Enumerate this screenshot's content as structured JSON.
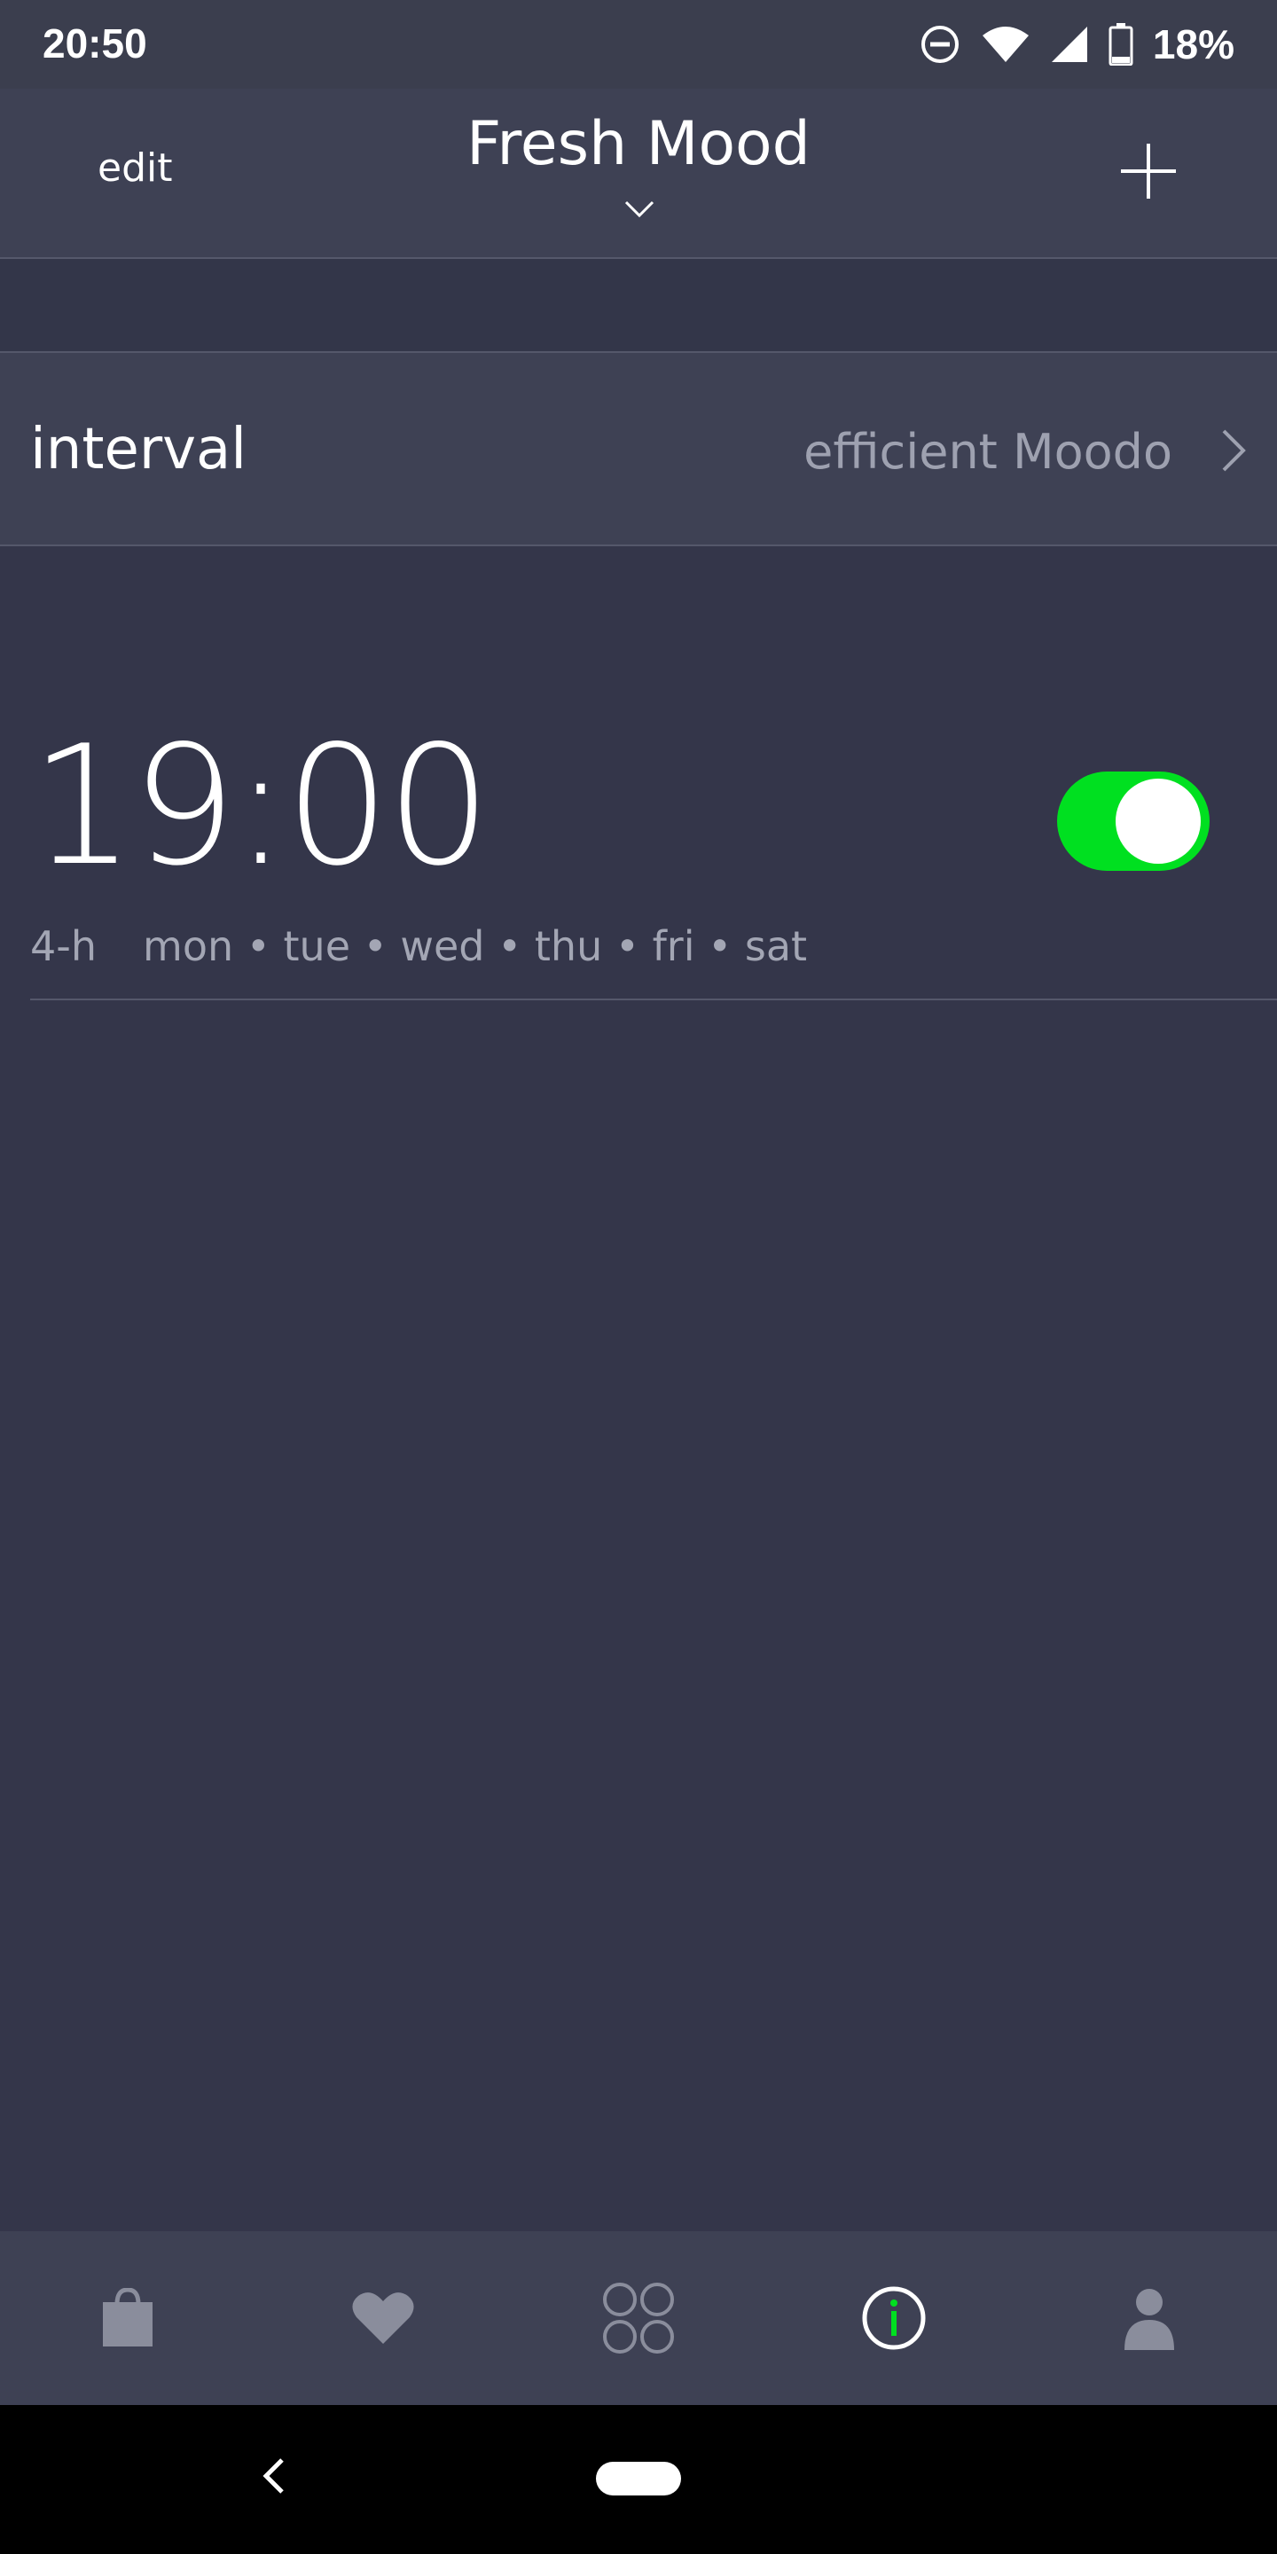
{
  "status_bar": {
    "time": "20:50",
    "battery_text": "18%",
    "icons": [
      "do-not-disturb-icon",
      "wifi-icon",
      "cell-signal-icon",
      "battery-icon"
    ]
  },
  "header": {
    "edit_label": "edit",
    "title": "Fresh Mood",
    "icons": [
      "chevron-down-icon",
      "plus-icon"
    ]
  },
  "interval": {
    "label": "interval",
    "value": "efficient Moodo",
    "icon": "chevron-right-icon"
  },
  "alarm": {
    "time": "19:00",
    "duration": "4-h",
    "days": "mon • tue • wed • thu • fri • sat",
    "enabled": true,
    "toggle_color": "#00e020"
  },
  "bottom_nav": {
    "items": [
      "shop-bag-icon",
      "heart-icon",
      "grid-circles-icon",
      "info-icon",
      "profile-icon"
    ],
    "active": "info-icon",
    "active_color": "#00e020",
    "inactive_color": "#8a8d9c"
  },
  "system_nav": {
    "icons": [
      "back-icon",
      "home-pill"
    ]
  },
  "colors": {
    "background": "#34364a",
    "panel": "#3e4154",
    "accent": "#00e020"
  }
}
